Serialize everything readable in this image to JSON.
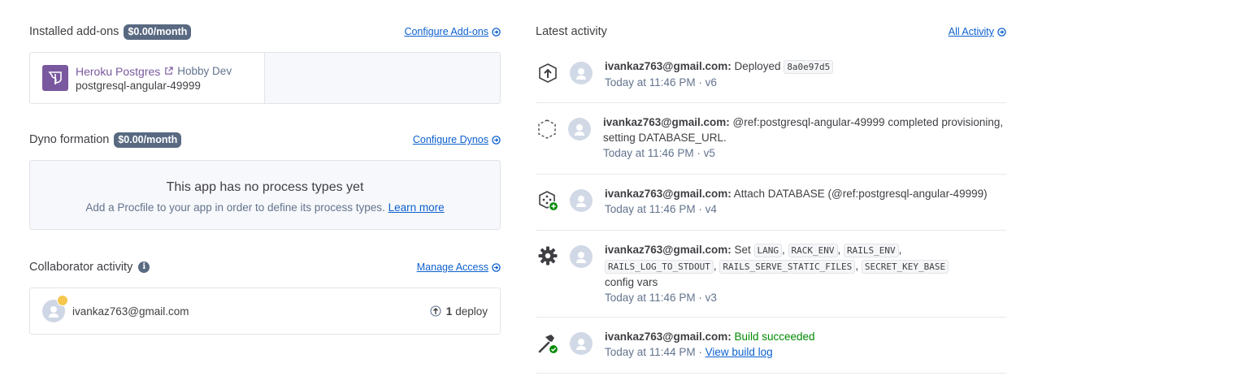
{
  "addons": {
    "title": "Installed add-ons",
    "price": "$0.00/month",
    "configure_label": "Configure Add-ons",
    "item": {
      "name": "Heroku Postgres",
      "plan": "Hobby Dev",
      "app": "postgresql-angular-49999"
    }
  },
  "dynos": {
    "title": "Dyno formation",
    "price": "$0.00/month",
    "configure_label": "Configure Dynos",
    "empty_title": "This app has no process types yet",
    "empty_text": "Add a Procfile to your app in order to define its process types.",
    "learn_more": "Learn more"
  },
  "collaborators": {
    "title": "Collaborator activity",
    "manage_label": "Manage Access",
    "email": "ivankaz763@gmail.com",
    "deploy_count": "1",
    "deploy_label": "deploy"
  },
  "activity": {
    "title": "Latest activity",
    "all_label": "All Activity",
    "items": [
      {
        "icon": "deploy-icon",
        "user": "ivankaz763@gmail.com:",
        "text": "Deployed",
        "code": "8a0e97d5",
        "time": "Today at 11:46 PM · v6"
      },
      {
        "icon": "provisioning-icon",
        "user": "ivankaz763@gmail.com:",
        "text": "@ref:postgresql-angular-49999 completed provisioning, setting DATABASE_URL.",
        "time": "Today at 11:46 PM · v5"
      },
      {
        "icon": "attach-addon-icon",
        "user": "ivankaz763@gmail.com:",
        "text": "Attach DATABASE (@ref:postgresql-angular-49999)",
        "time": "Today at 11:46 PM · v4"
      },
      {
        "icon": "gear-icon",
        "user": "ivankaz763@gmail.com:",
        "text_before": "Set",
        "vars": [
          "LANG",
          "RACK_ENV",
          "RAILS_ENV",
          "RAILS_LOG_TO_STDOUT",
          "RAILS_SERVE_STATIC_FILES",
          "SECRET_KEY_BASE"
        ],
        "text_after": "config vars",
        "time": "Today at 11:46 PM · v3"
      },
      {
        "icon": "build-icon",
        "user": "ivankaz763@gmail.com:",
        "text": "Build succeeded",
        "time": "Today at 11:44 PM ·",
        "link": "View build log"
      }
    ]
  },
  "colors": {
    "link": "#0c60ce",
    "badge": "#596981",
    "postgres": "#79589f",
    "success": "#008a00"
  }
}
